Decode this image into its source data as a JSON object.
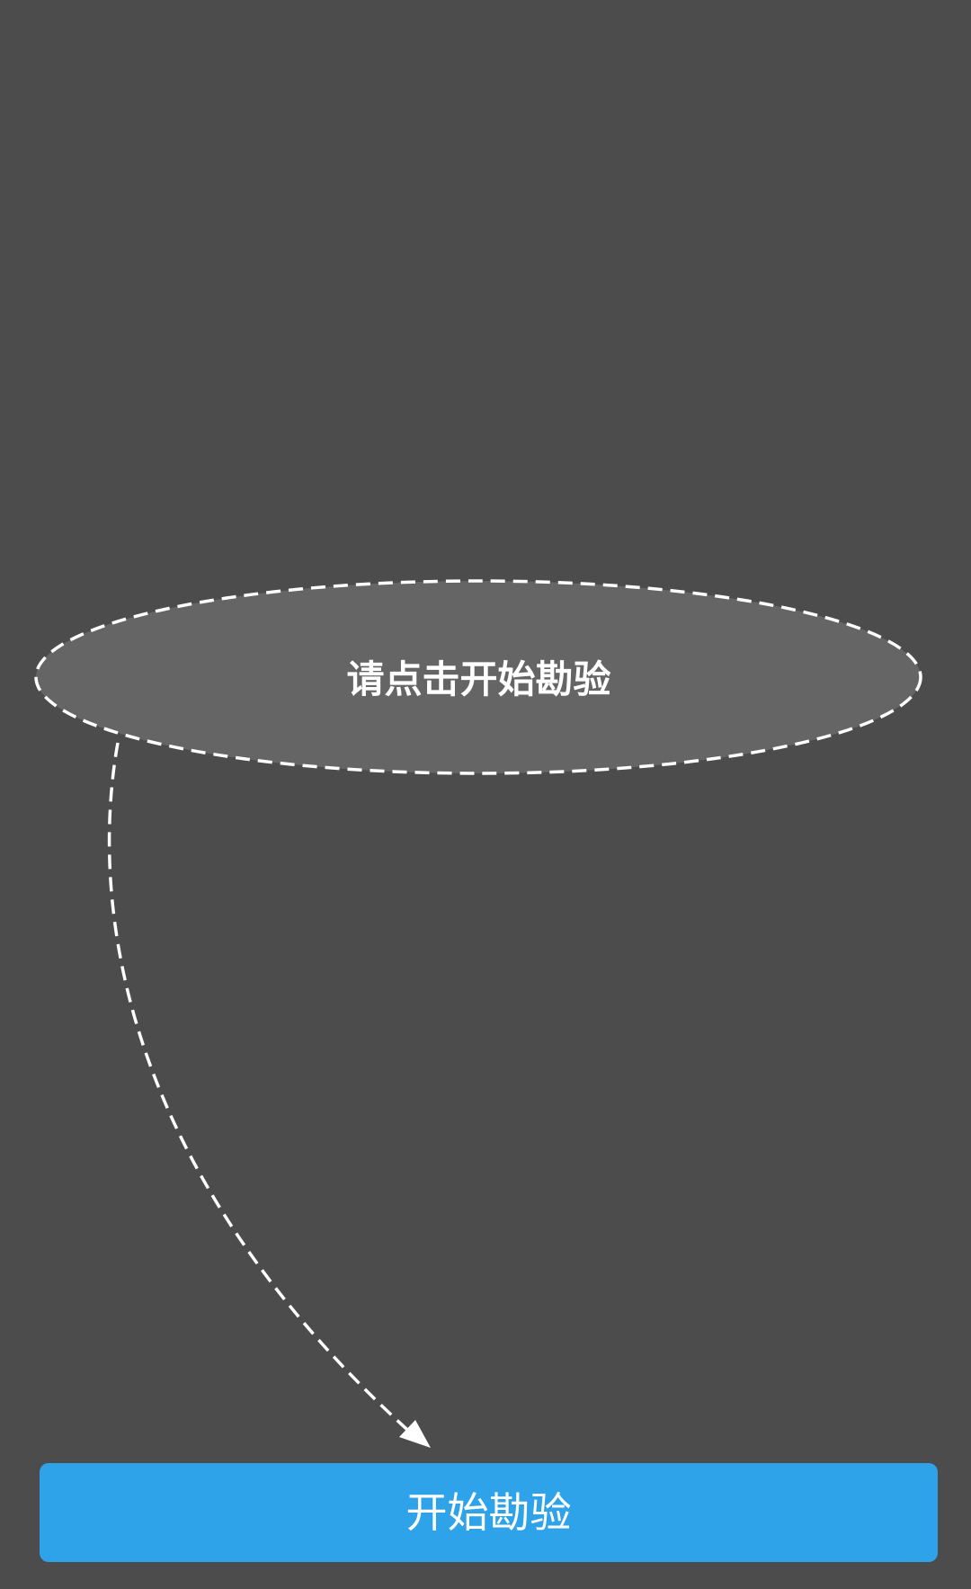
{
  "guide": {
    "hint_text": "请点击开始勘验",
    "ellipse_fill": "#656565",
    "stroke_color": "#ffffff"
  },
  "actions": {
    "start_label": "开始勘验"
  },
  "colors": {
    "background": "#4c4c4c",
    "accent": "#2fa3ea",
    "button_text": "#ffffff"
  }
}
